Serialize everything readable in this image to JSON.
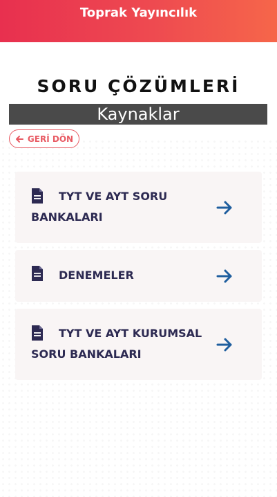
{
  "header": {
    "brand": "Toprak Yayıncılık"
  },
  "page": {
    "title": "SORU ÇÖZÜMLERİ",
    "subtitle": "Kaynaklar",
    "back_label": "GERİ DÖN"
  },
  "cards": [
    {
      "label": "TYT VE AYT SORU BANKALARI",
      "icon": "document-icon",
      "action_icon": "arrow-right-icon"
    },
    {
      "label": "DENEMELER",
      "icon": "document-icon",
      "action_icon": "arrow-right-icon"
    },
    {
      "label": "TYT VE AYT KURUMSAL SORU BANKALARI",
      "icon": "document-icon",
      "action_icon": "arrow-right-icon"
    }
  ],
  "colors": {
    "header_start": "#e8304f",
    "header_end": "#f6664a",
    "accent_red": "#e85a63",
    "text_navy": "#2d2a52",
    "arrow_blue": "#1f5e9e",
    "card_bg": "#f9f5f5"
  }
}
